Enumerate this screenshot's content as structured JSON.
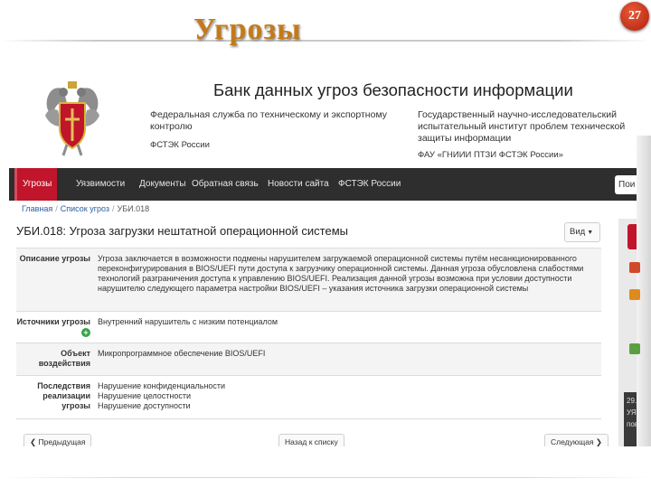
{
  "slide": {
    "title": "Угрозы",
    "page_number": "27"
  },
  "site": {
    "title": "Банк данных угроз безопасности информации",
    "org_left": {
      "name": "Федеральная служба по техническому и экспортному контролю",
      "abbr": "ФСТЭК России"
    },
    "org_right": {
      "name": "Государственный научно-исследовательский испытательный институт проблем технической защиты информации",
      "abbr": "ФАУ «ГНИИИ ПТЗИ ФСТЭК России»"
    }
  },
  "nav": {
    "items": [
      "Угрозы",
      "Уязвимости",
      "Документы",
      "Обратная связь",
      "Новости сайта",
      "ФСТЭК России"
    ],
    "active": "Угрозы",
    "search_label": "Пои"
  },
  "breadcrumb": {
    "home": "Главная",
    "list": "Список угроз",
    "current": "УБИ.018"
  },
  "threat": {
    "title": "УБИ.018: Угроза загрузки нештатной операционной системы",
    "view_button": "Вид",
    "rows": [
      {
        "label": "Описание угрозы",
        "value": "Угроза заключается в возможности подмены нарушителем загружаемой операционной системы путём несанкционированного переконфигурирования в BIOS/UEFI пути доступа к загрузчику операционной системы. Данная угроза обусловлена слабостями технологий разграничения доступа к управлению BIOS/UEFI. Реализация данной угрозы возможна при условии доступности нарушителю следующего параметра настройки BIOS/UEFI – указания источника загрузки операционной системы"
      },
      {
        "label": "Источники угрозы",
        "value": "Внутренний нарушитель с низким потенциалом"
      },
      {
        "label": "Объект воздействия",
        "value": "Микропрограммное обеспечение BIOS/UEFI"
      },
      {
        "label": "Последствия реализации угрозы",
        "value": [
          "Нарушение конфиденциальности",
          "Нарушение целостности",
          "Нарушение доступности"
        ]
      }
    ]
  },
  "pager": {
    "prev": "Предыдущая",
    "back": "Назад к списку",
    "next": "Следующая"
  },
  "side": {
    "lines": [
      "29.",
      "УЯЗ",
      "пов"
    ]
  }
}
